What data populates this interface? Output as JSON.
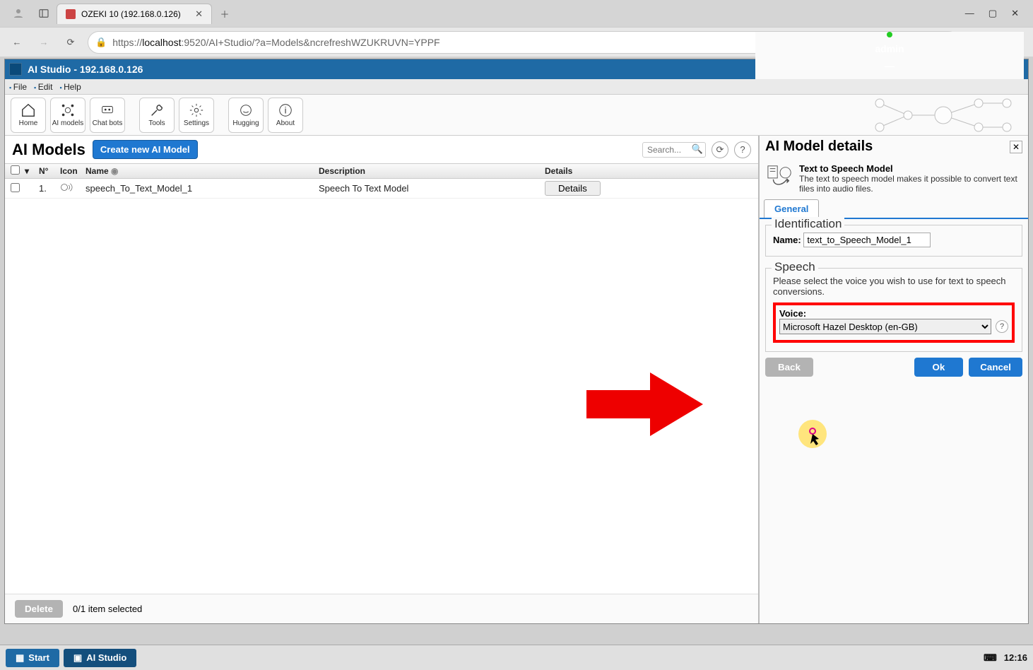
{
  "browser": {
    "tab_title": "OZEKI 10 (192.168.0.126)",
    "url_prefix": "https://",
    "url_host": "localhost",
    "url_rest": ":9520/AI+Studio/?a=Models&ncrefreshWZUKRUVN=YPPF"
  },
  "app": {
    "title": "AI Studio - 192.168.0.126",
    "user": "admin",
    "menus": [
      "File",
      "Edit",
      "Help"
    ],
    "tools": [
      "Home",
      "AI models",
      "Chat bots",
      "Tools",
      "Settings",
      "Hugging",
      "About"
    ]
  },
  "models": {
    "heading": "AI Models",
    "create_btn": "Create new AI Model",
    "search_placeholder": "Search...",
    "cols": {
      "num": "N°",
      "icon": "Icon",
      "name": "Name",
      "desc": "Description",
      "det": "Details"
    },
    "rows": [
      {
        "num": "1.",
        "name": "speech_To_Text_Model_1",
        "desc": "Speech To Text Model",
        "det": "Details"
      }
    ],
    "delete_btn": "Delete",
    "selection": "0/1 item selected"
  },
  "details": {
    "heading": "AI Model details",
    "model_title": "Text to Speech Model",
    "model_desc": "The text to speech model makes it possible to convert text files into audio files.",
    "tab": "General",
    "ident_legend": "Identification",
    "name_label": "Name:",
    "name_value": "text_to_Speech_Model_1",
    "speech_legend": "Speech",
    "speech_hint": "Please select the voice you wish to use for text to speech conversions.",
    "voice_label": "Voice:",
    "voice_value": "Microsoft Hazel Desktop (en-GB)",
    "back": "Back",
    "ok": "Ok",
    "cancel": "Cancel"
  },
  "taskbar": {
    "start": "Start",
    "app": "AI Studio",
    "clock": "12:16"
  }
}
